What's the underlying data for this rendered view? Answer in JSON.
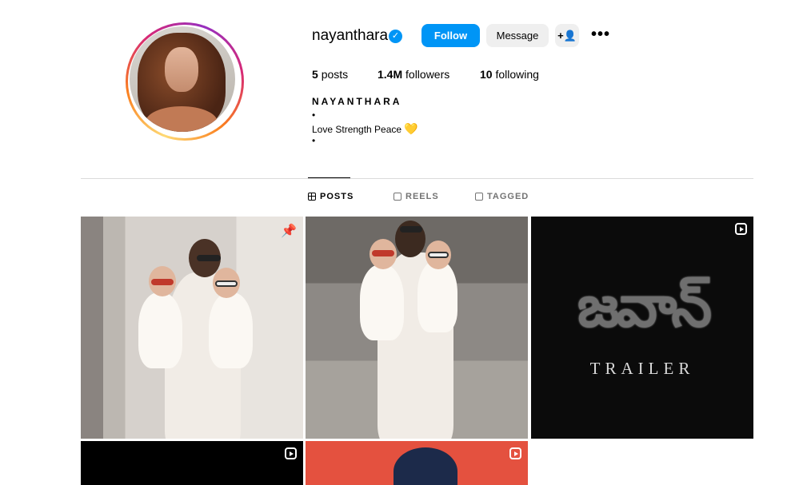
{
  "profile": {
    "username": "nayanthara",
    "full_name": "NAYANTHARA",
    "bio_lines": [
      "•",
      "Love Strength Peace",
      "•"
    ],
    "bio_emoji": "💛"
  },
  "actions": {
    "follow_label": "Follow",
    "message_label": "Message",
    "add_user_icon": "+👤",
    "more_icon": "•••"
  },
  "stats": {
    "posts_count": "5",
    "posts_label": "posts",
    "followers_count": "1.4M",
    "followers_label": "followers",
    "following_count": "10",
    "following_label": "following"
  },
  "tabs": [
    {
      "label": "POSTS",
      "active": true
    },
    {
      "label": "REELS",
      "active": false
    },
    {
      "label": "TAGGED",
      "active": false
    }
  ],
  "posts": [
    {
      "type": "photo",
      "pinned": true
    },
    {
      "type": "photo",
      "pinned": false
    },
    {
      "type": "reel",
      "title_art": "జవాన్",
      "caption": "TRAILER"
    },
    {
      "type": "reel"
    },
    {
      "type": "reel"
    }
  ],
  "colors": {
    "accent": "#0095f6",
    "button_bg": "#efefef",
    "divider": "#dbdbdb",
    "muted_text": "#737373"
  }
}
